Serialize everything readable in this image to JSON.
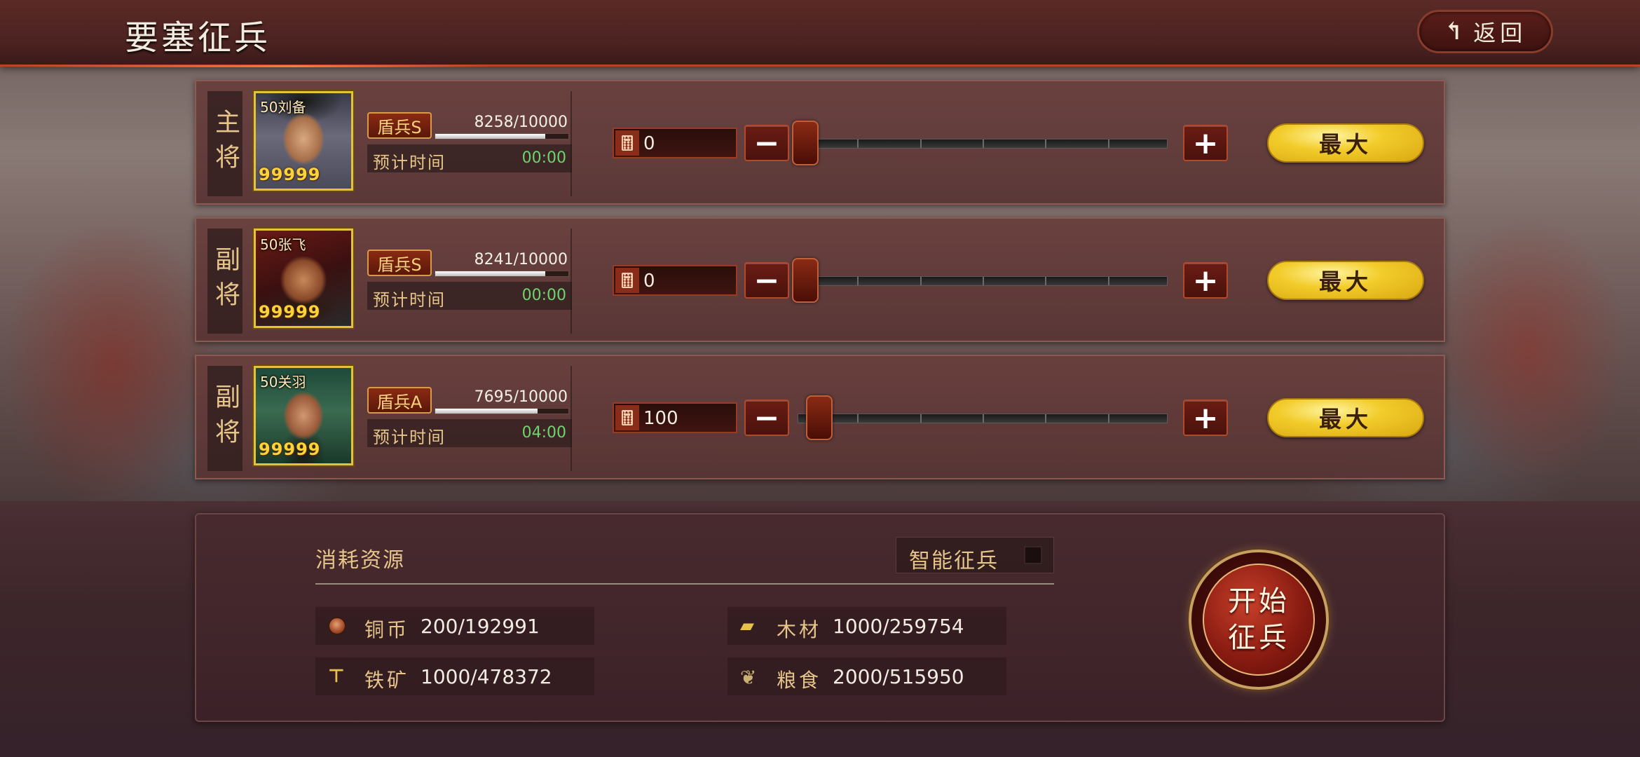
{
  "header": {
    "title": "要塞征兵",
    "back_label": "返回",
    "back_icon": "return-arrow-icon"
  },
  "generals": [
    {
      "role": "主将",
      "name_level": "50刘备",
      "stars": "99999",
      "troop_type": "盾兵S",
      "troops": "8258/10000",
      "troops_fraction": 0.8258,
      "eta_label": "预计时间",
      "eta": "00:00",
      "qty": "0",
      "slider_fraction": 0.0,
      "max_label": "最大"
    },
    {
      "role": "副将",
      "name_level": "50张飞",
      "stars": "99999",
      "troop_type": "盾兵S",
      "troops": "8241/10000",
      "troops_fraction": 0.8241,
      "eta_label": "预计时间",
      "eta": "00:00",
      "qty": "0",
      "slider_fraction": 0.0,
      "max_label": "最大"
    },
    {
      "role": "副将",
      "name_level": "50关羽",
      "stars": "99999",
      "troop_type": "盾兵A",
      "troops": "7695/10000",
      "troops_fraction": 0.7695,
      "eta_label": "预计时间",
      "eta": "04:00",
      "qty": "100",
      "slider_fraction": 0.04,
      "max_label": "最大"
    }
  ],
  "resources": {
    "title": "消耗资源",
    "smart_recruit_label": "智能征兵",
    "smart_recruit_checked": false,
    "items": [
      {
        "icon": "copper-coin-icon",
        "label": "铜币",
        "value": "200/192991"
      },
      {
        "icon": "wood-icon",
        "label": "木材",
        "value": "1000/259754"
      },
      {
        "icon": "iron-ore-icon",
        "label": "铁矿",
        "value": "1000/478372"
      },
      {
        "icon": "grain-icon",
        "label": "粮食",
        "value": "2000/515950"
      }
    ]
  },
  "start_button": {
    "line1": "开始",
    "line2": "征兵"
  },
  "colors": {
    "accent_gold": "#f2cc2a",
    "header_red": "#b4442a",
    "label_gold": "#e5c58a",
    "eta_green": "#6ed46e"
  }
}
